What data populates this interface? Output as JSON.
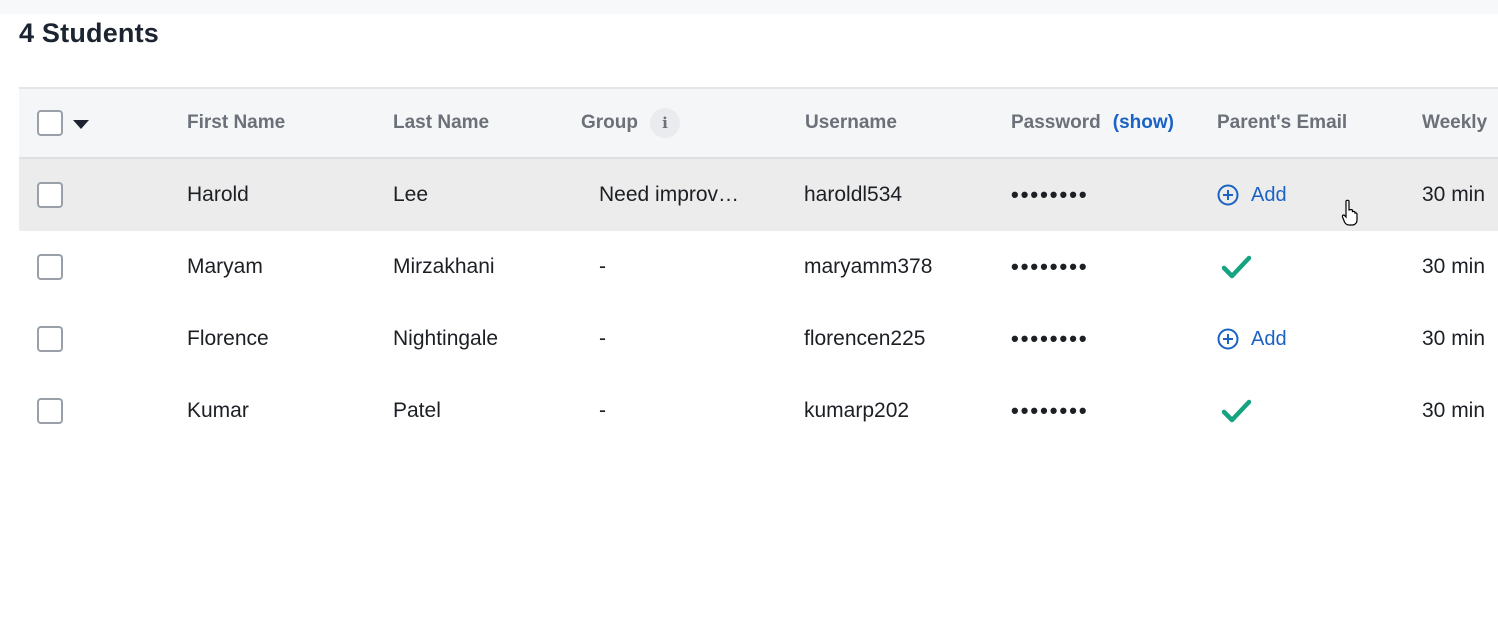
{
  "title": "4 Students",
  "columns": {
    "first_name": "First Name",
    "last_name": "Last Name",
    "group": "Group",
    "group_info_icon": "info-icon",
    "username": "Username",
    "password": "Password",
    "password_show": "(show)",
    "parents_email": "Parent's Email",
    "weekly": "Weekly"
  },
  "add_label": "Add",
  "colors": {
    "link": "#1a62c4",
    "check": "#16a37f",
    "hover_row": "#ececec"
  },
  "students": [
    {
      "first": "Harold",
      "last": "Lee",
      "group": "Need improv…",
      "username": "haroldl534",
      "password": "••••••••",
      "parent_email": "add",
      "weekly": "30 min"
    },
    {
      "first": "Maryam",
      "last": "Mirzakhani",
      "group": "-",
      "username": "maryamm378",
      "password": "••••••••",
      "parent_email": "check",
      "weekly": "30 min"
    },
    {
      "first": "Florence",
      "last": "Nightingale",
      "group": "-",
      "username": "florencen225",
      "password": "••••••••",
      "parent_email": "add",
      "weekly": "30 min"
    },
    {
      "first": "Kumar",
      "last": "Patel",
      "group": "-",
      "username": "kumarp202",
      "password": "••••••••",
      "parent_email": "check",
      "weekly": "30 min"
    }
  ]
}
